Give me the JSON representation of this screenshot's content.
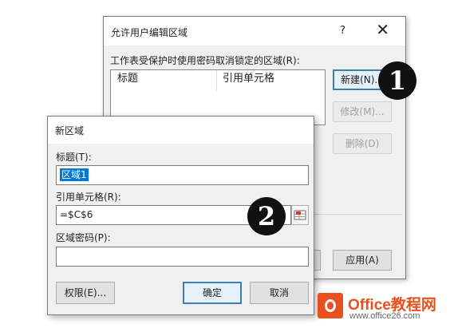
{
  "back_dialog": {
    "title": "允许用户编辑区域",
    "help_glyph": "?",
    "close_glyph": "✕",
    "list_caption": "工作表受保护时使用密码取消锁定的区域(R):",
    "list_columns": [
      "标题",
      "引用单元格"
    ],
    "buttons": {
      "new": "新建(N)...",
      "modify": "修改(M)...",
      "delete": "删除(D)",
      "apply": "应用(A)"
    }
  },
  "front_dialog": {
    "title": "新区域",
    "title_label": "标题(T):",
    "title_value": "区域1",
    "ref_label": "引用单元格(R):",
    "ref_value": "=$C$6",
    "password_label": "区域密码(P):",
    "password_value": "",
    "buttons": {
      "permissions": "权限(E)...",
      "ok": "确定",
      "cancel": "取消"
    }
  },
  "badges": [
    "1",
    "2"
  ],
  "watermark": {
    "line1": "Office教程网",
    "line2": "www.office26.com"
  },
  "colors": {
    "selection": "#0078d7",
    "default_button_border": "#3c7fb1",
    "brand": "#e8501f"
  }
}
